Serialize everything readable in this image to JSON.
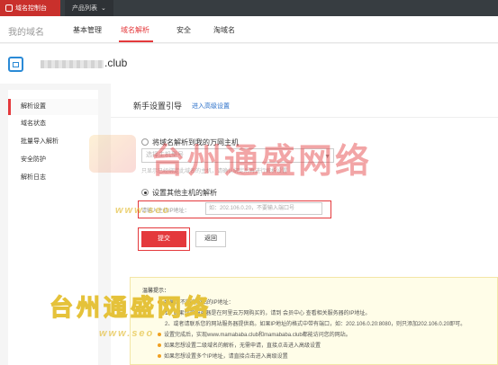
{
  "topbar": {
    "brand": "域名控制台",
    "products": "产品列表"
  },
  "navbar": {
    "my_domain": "我的域名",
    "tabs": [
      "基本管理",
      "域名解析",
      "安全",
      "淘域名"
    ]
  },
  "domain": {
    "tld": ".club"
  },
  "sidebar": {
    "items": [
      "解析设置",
      "域名状态",
      "批量导入解析",
      "安全防护",
      "解析日志"
    ]
  },
  "content": {
    "title": "新手设置引导",
    "advanced_link": "进入高级设置",
    "option1_label": "将域名解析到我的万网主机",
    "option1_select": "选择主机型号",
    "option1_hint": "只显示已经绑定此域名的主机，请确认绑定后再进行解析设置",
    "option2_label": "设置其他主机的解析",
    "ip_label": "请输入主机IP地址：",
    "ip_placeholder": "如：202.106.0.20，不要输入端口号",
    "submit": "提交",
    "back": "返回"
  },
  "tips": {
    "heading": "温馨提示：",
    "lines": [
      "如果您不知道网站的IP地址：",
      "1、如果您的服务器是在阿里云万网购买的，请到 会员中心 查看相关服务器的IP地址。",
      "2、或者请联系您的网站服务器提供商。如果IP地址的格式中带有端口，如：202.106.0.20:8080，则只添加202.106.0.20即可。",
      "设置完成后，实现www.mamababa.club和mamababa.club都能访问您的网站。",
      "如果您想设置二级域名的解析，无需申请，直接点击进入高级设置",
      "如果您想设置多个IP地址，请直接点击进入高级设置"
    ]
  },
  "watermark": {
    "text1": "台州通盛网络",
    "text2": "台州通盛网络",
    "sub1": "www.seo",
    "sub2": "www.seo"
  }
}
